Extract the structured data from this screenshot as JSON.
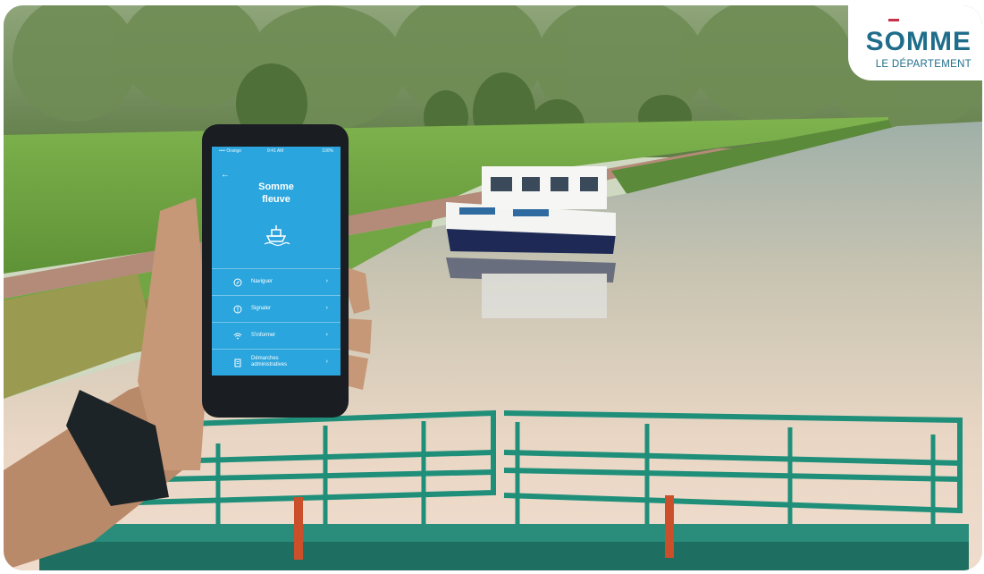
{
  "brand": {
    "logo_top": "SOMME",
    "logo_sub": "LE DÉPARTEMENT"
  },
  "phone": {
    "status": {
      "carrier": "•••• Orange",
      "time": "9:41 AM",
      "battery": "100%"
    },
    "app_title_line1": "Somme",
    "app_title_line2": "fleuve",
    "menu": [
      {
        "label": "Naviguer",
        "icon": "compass-icon"
      },
      {
        "label": "Signaler",
        "icon": "alert-icon"
      },
      {
        "label": "S'informer",
        "icon": "wifi-icon"
      },
      {
        "label": "Démarches administratives",
        "icon": "document-icon"
      }
    ]
  },
  "colors": {
    "app_blue": "#2aa5dd",
    "brand_blue": "#1f6d8a",
    "brand_red": "#c8314a",
    "railing_green": "#1f8f7a"
  }
}
